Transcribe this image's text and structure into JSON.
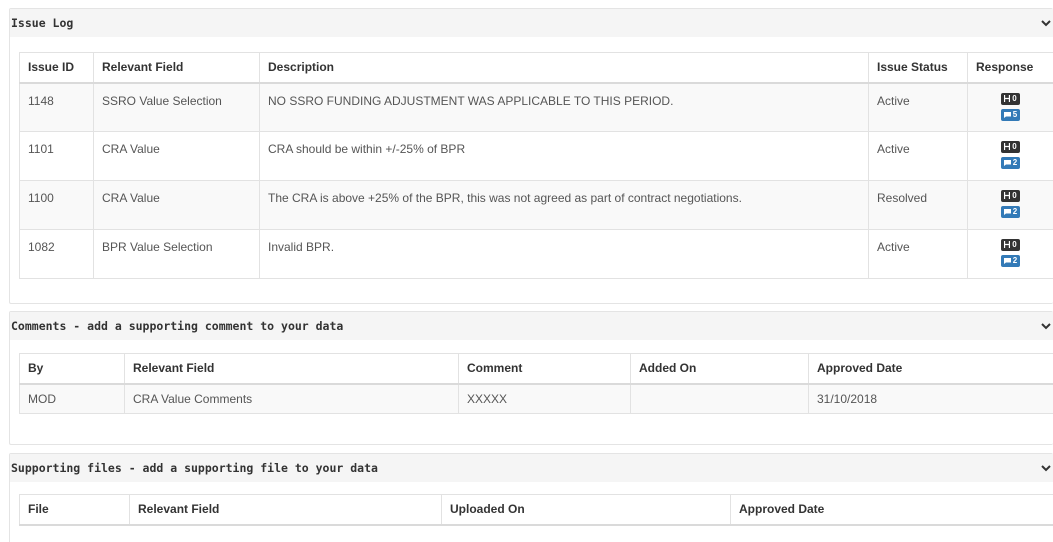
{
  "issue_log": {
    "title": "Issue Log",
    "headers": [
      "Issue ID",
      "Relevant Field",
      "Description",
      "Issue Status",
      "Response"
    ],
    "rows": [
      {
        "id": "1148",
        "field": "SSRO Value Selection",
        "description": "NO SSRO FUNDING ADJUSTMENT WAS APPLICABLE TO THIS PERIOD.",
        "status": "Active",
        "h_count": "0",
        "c_count": "5"
      },
      {
        "id": "1101",
        "field": "CRA Value",
        "description": "CRA should be within +/-25% of BPR",
        "status": "Active",
        "h_count": "0",
        "c_count": "2"
      },
      {
        "id": "1100",
        "field": "CRA Value",
        "description": "The CRA is above +25% of the BPR, this was not agreed as part of contract negotiations.",
        "status": "Resolved",
        "h_count": "0",
        "c_count": "2"
      },
      {
        "id": "1082",
        "field": "BPR Value Selection",
        "description": "Invalid BPR.",
        "status": "Active",
        "h_count": "0",
        "c_count": "2"
      }
    ]
  },
  "comments": {
    "title": "Comments - add a supporting comment to your data",
    "headers": [
      "By",
      "Relevant Field",
      "Comment",
      "Added On",
      "Approved Date"
    ],
    "rows": [
      {
        "by": "MOD",
        "field": "CRA Value Comments",
        "comment": "XXXXX",
        "added_on": "",
        "approved": "31/10/2018"
      }
    ]
  },
  "files": {
    "title": "Supporting files - add a supporting file to your data",
    "headers": [
      "File",
      "Relevant Field",
      "Uploaded On",
      "Approved Date"
    ]
  },
  "colors": {
    "header_bg": "#f5f5f5",
    "badge_dark": "#333333",
    "badge_blue": "#337ab7"
  },
  "icons": {
    "collapse": "chevron-down-icon",
    "history": "h-icon",
    "comment": "comment-icon"
  }
}
